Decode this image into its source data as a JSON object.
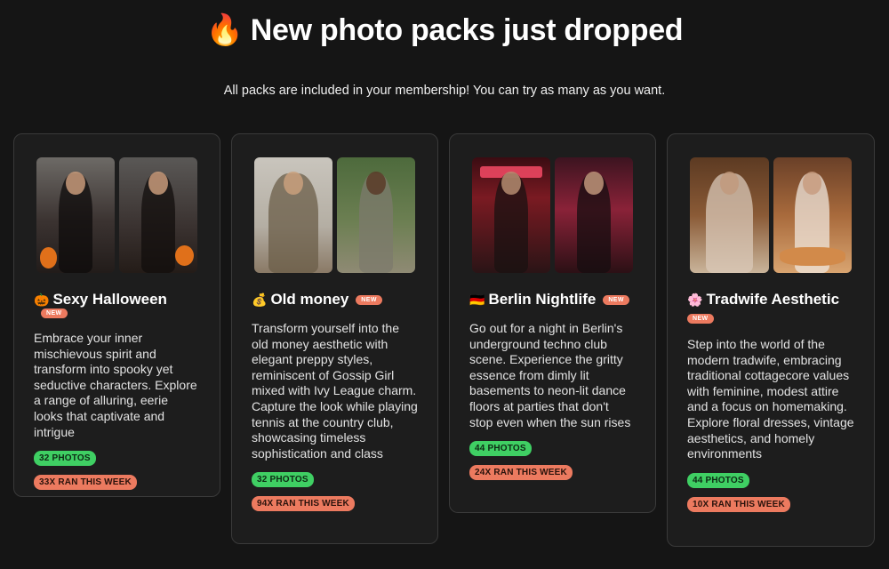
{
  "header": {
    "emoji": "🔥",
    "title": "New photo packs just dropped",
    "subtitle": "All packs are included in your membership! You can try as many as you want."
  },
  "packs": [
    {
      "emoji": "🎃",
      "name": "Sexy Halloween",
      "badge": "NEW",
      "description": "Embrace your inner mischievous spirit and transform into spooky yet seductive characters. Explore a range of alluring, eerie looks that captivate and intrigue",
      "photos": "32 PHOTOS",
      "runs": "33X RAN THIS WEEK"
    },
    {
      "emoji": "💰",
      "name": "Old money",
      "badge": "NEW",
      "description": "Transform yourself into the old money aesthetic with elegant preppy styles, reminiscent of Gossip Girl mixed with Ivy League charm. Capture the look while playing tennis at the country club, showcasing timeless sophistication and class",
      "photos": "32 PHOTOS",
      "runs": "94X RAN THIS WEEK"
    },
    {
      "emoji": "🇩🇪",
      "name": "Berlin Nightlife",
      "badge": "NEW",
      "description": "Go out for a night in Berlin's underground techno club scene. Experience the gritty essence from dimly lit basements to neon-lit dance floors at parties that don't stop even when the sun rises",
      "photos": "44 PHOTOS",
      "runs": "24X RAN THIS WEEK"
    },
    {
      "emoji": "🌸",
      "name": "Tradwife Aesthetic",
      "badge": "NEW",
      "description": "Step into the world of the modern tradwife, embracing traditional cottagecore values with feminine, modest attire and a focus on homemaking. Explore floral dresses, vintage aesthetics, and homely environments",
      "photos": "44 PHOTOS",
      "runs": "10X RAN THIS WEEK"
    }
  ],
  "colors": {
    "background": "#151515",
    "card": "#1d1d1d",
    "badge_green": "#3fcf63",
    "badge_orange": "#ec7a5f"
  }
}
